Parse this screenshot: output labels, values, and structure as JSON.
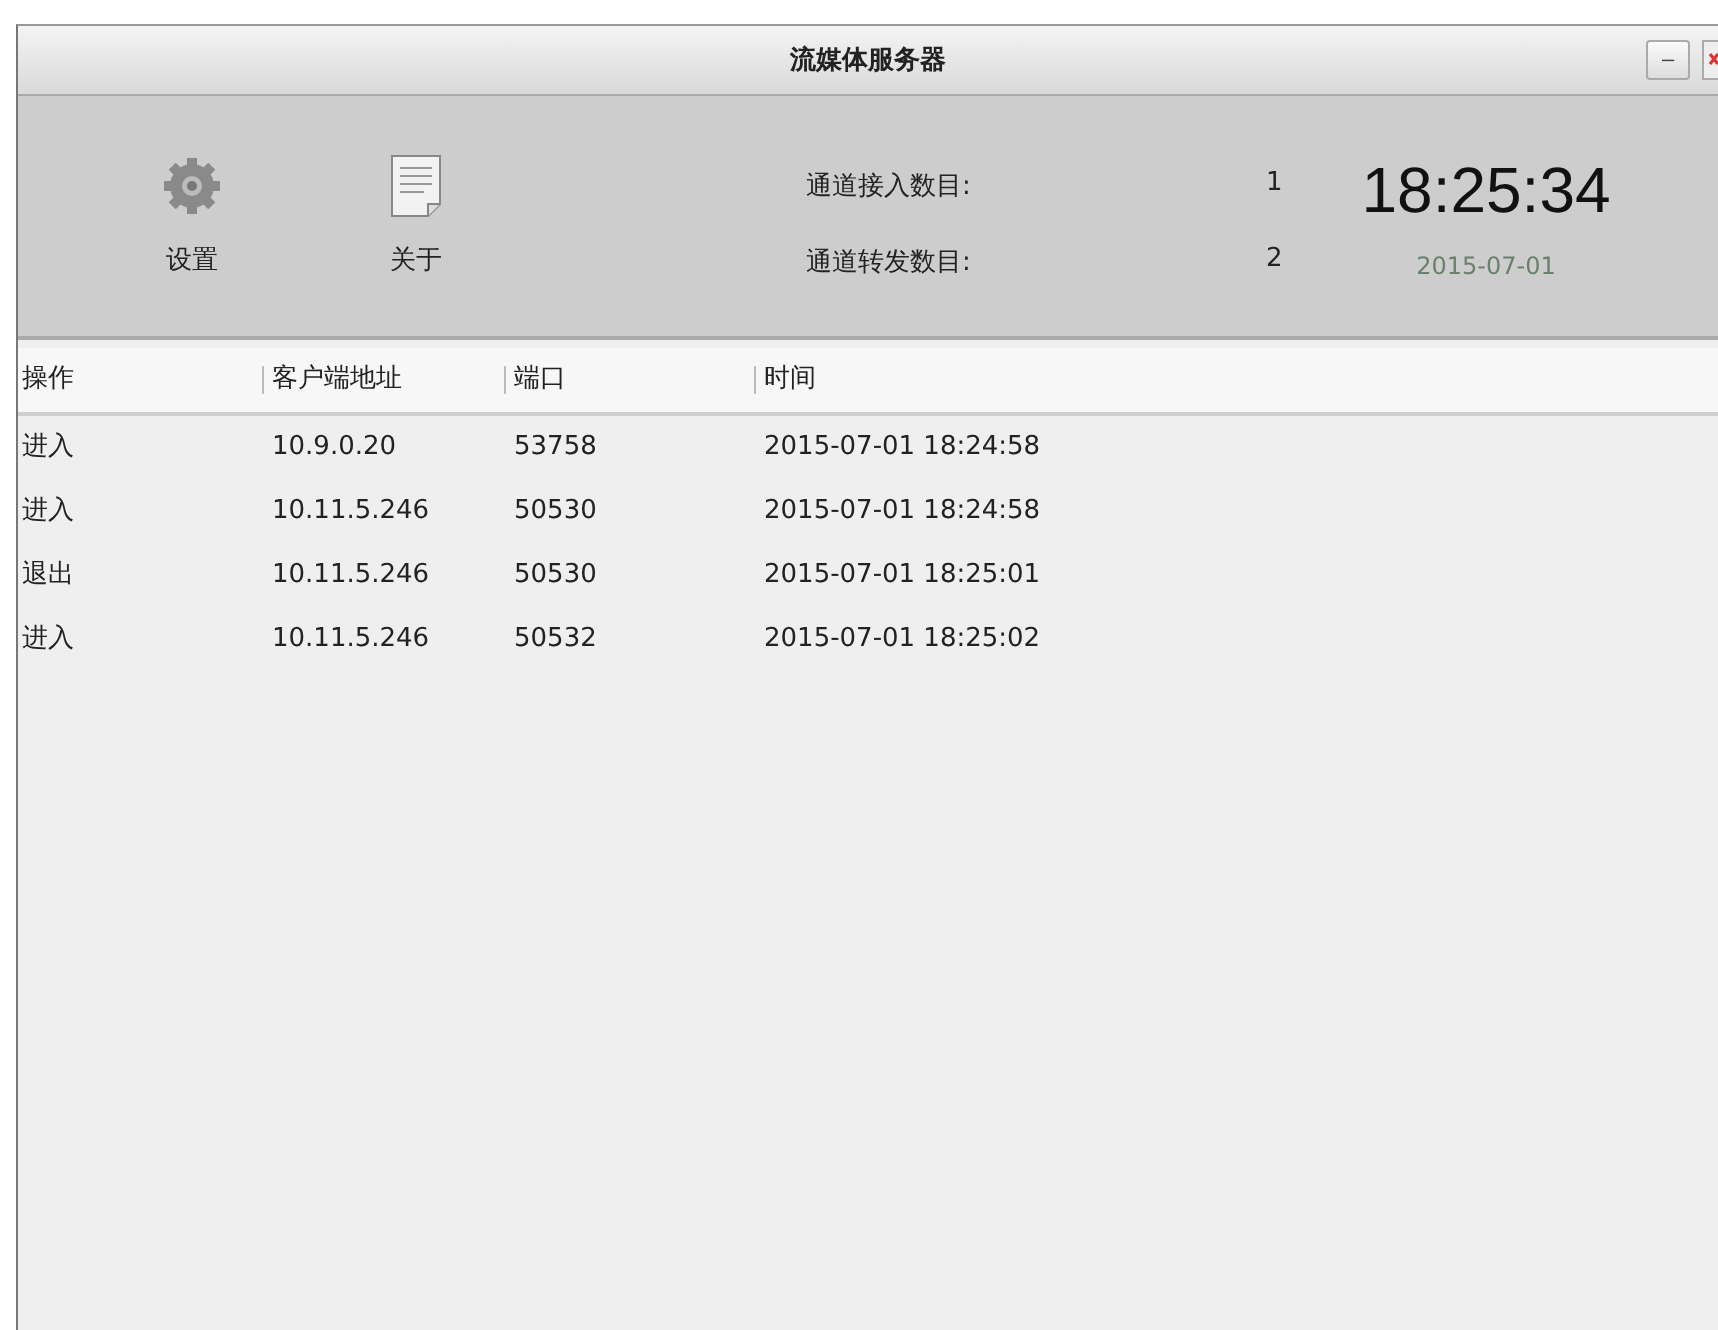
{
  "window": {
    "title": "流媒体服务器",
    "minimize": "–"
  },
  "toolbar": {
    "buttons": [
      {
        "kind": "settings",
        "label": "设置"
      },
      {
        "kind": "about",
        "label": "关于"
      }
    ]
  },
  "stats": [
    {
      "label": "通道接入数目:",
      "value": "1"
    },
    {
      "label": "通道转发数目:",
      "value": "2"
    }
  ],
  "clock": {
    "time": "18:25:34",
    "date": "2015-07-01"
  },
  "table": {
    "columns": [
      "操作",
      "客户端地址",
      "端口",
      "时间"
    ],
    "rows": [
      [
        "进入",
        "10.9.0.20",
        "53758",
        "2015-07-01 18:24:58"
      ],
      [
        "进入",
        "10.11.5.246",
        "50530",
        "2015-07-01 18:24:58"
      ],
      [
        "退出",
        "10.11.5.246",
        "50530",
        "2015-07-01 18:25:01"
      ],
      [
        "进入",
        "10.11.5.246",
        "50532",
        "2015-07-01 18:25:02"
      ]
    ]
  }
}
